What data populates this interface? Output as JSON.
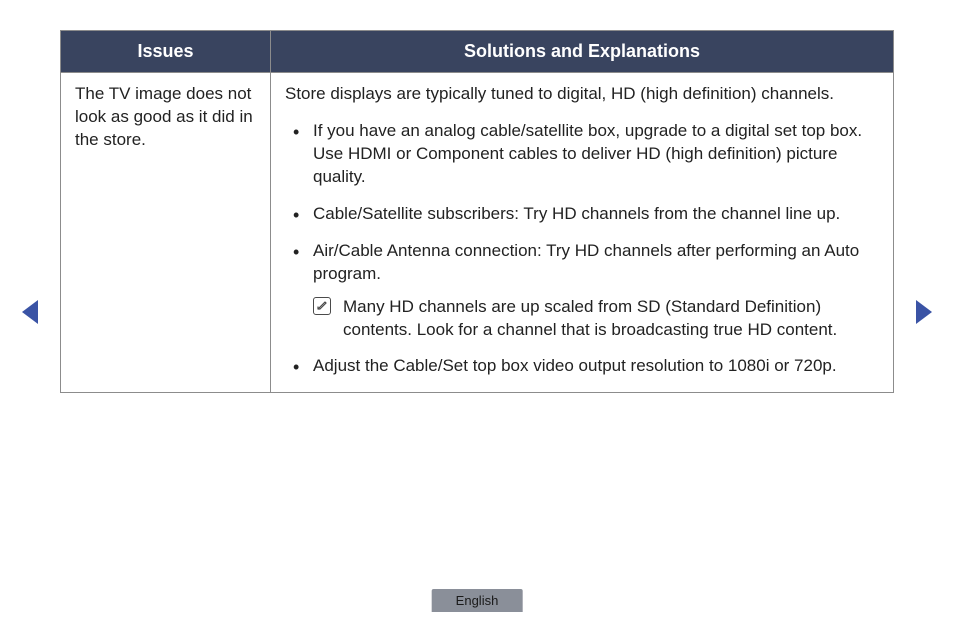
{
  "table": {
    "header": {
      "col1": "Issues",
      "col2": "Solutions and Explanations"
    },
    "issue": "The TV image does not look as good as it did in the store.",
    "intro": "Store displays are typically tuned to digital, HD (high definition) channels.",
    "bullets": [
      "If you have an analog cable/satellite box, upgrade to a digital set top box. Use HDMI or Component cables to deliver HD (high definition) picture quality.",
      "Cable/Satellite subscribers: Try HD channels from the channel line up.",
      "Air/Cable Antenna connection: Try HD channels after performing an Auto program.",
      "Adjust the Cable/Set top box video output resolution to 1080i or 720p."
    ],
    "note": "Many HD channels are up scaled from SD (Standard Definition) contents. Look for a channel that is broadcasting true HD content."
  },
  "language": "English"
}
